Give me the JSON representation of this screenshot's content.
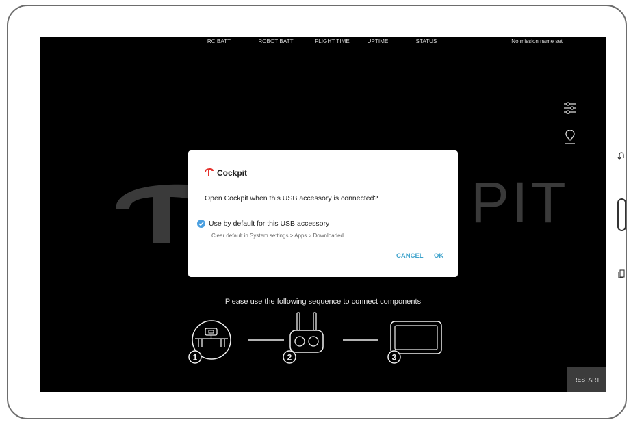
{
  "topbar": {
    "stats": [
      "RC BATT",
      "ROBOT BATT",
      "FLIGHT TIME",
      "UPTIME",
      "STATUS"
    ],
    "mission": "No mission name set"
  },
  "background": {
    "logo_text": "PIT"
  },
  "dialog": {
    "app_name": "Cockpit",
    "message": "Open Cockpit when this USB accessory is connected?",
    "checkbox_label": "Use by default for this USB accessory",
    "checkbox_checked": true,
    "sub_text": "Clear default in System settings > Apps > Downloaded.",
    "cancel_label": "CANCEL",
    "ok_label": "OK",
    "accent_color": "#3fa3cc",
    "logo_color": "#e5322d"
  },
  "sequence": {
    "instruction": "Please use the following sequence to connect components",
    "steps": [
      "1",
      "2",
      "3"
    ]
  },
  "restart_label": "RESTART",
  "icons": [
    "sliders-icon",
    "location-pin-icon",
    "back-icon",
    "home-button",
    "recents-icon"
  ]
}
